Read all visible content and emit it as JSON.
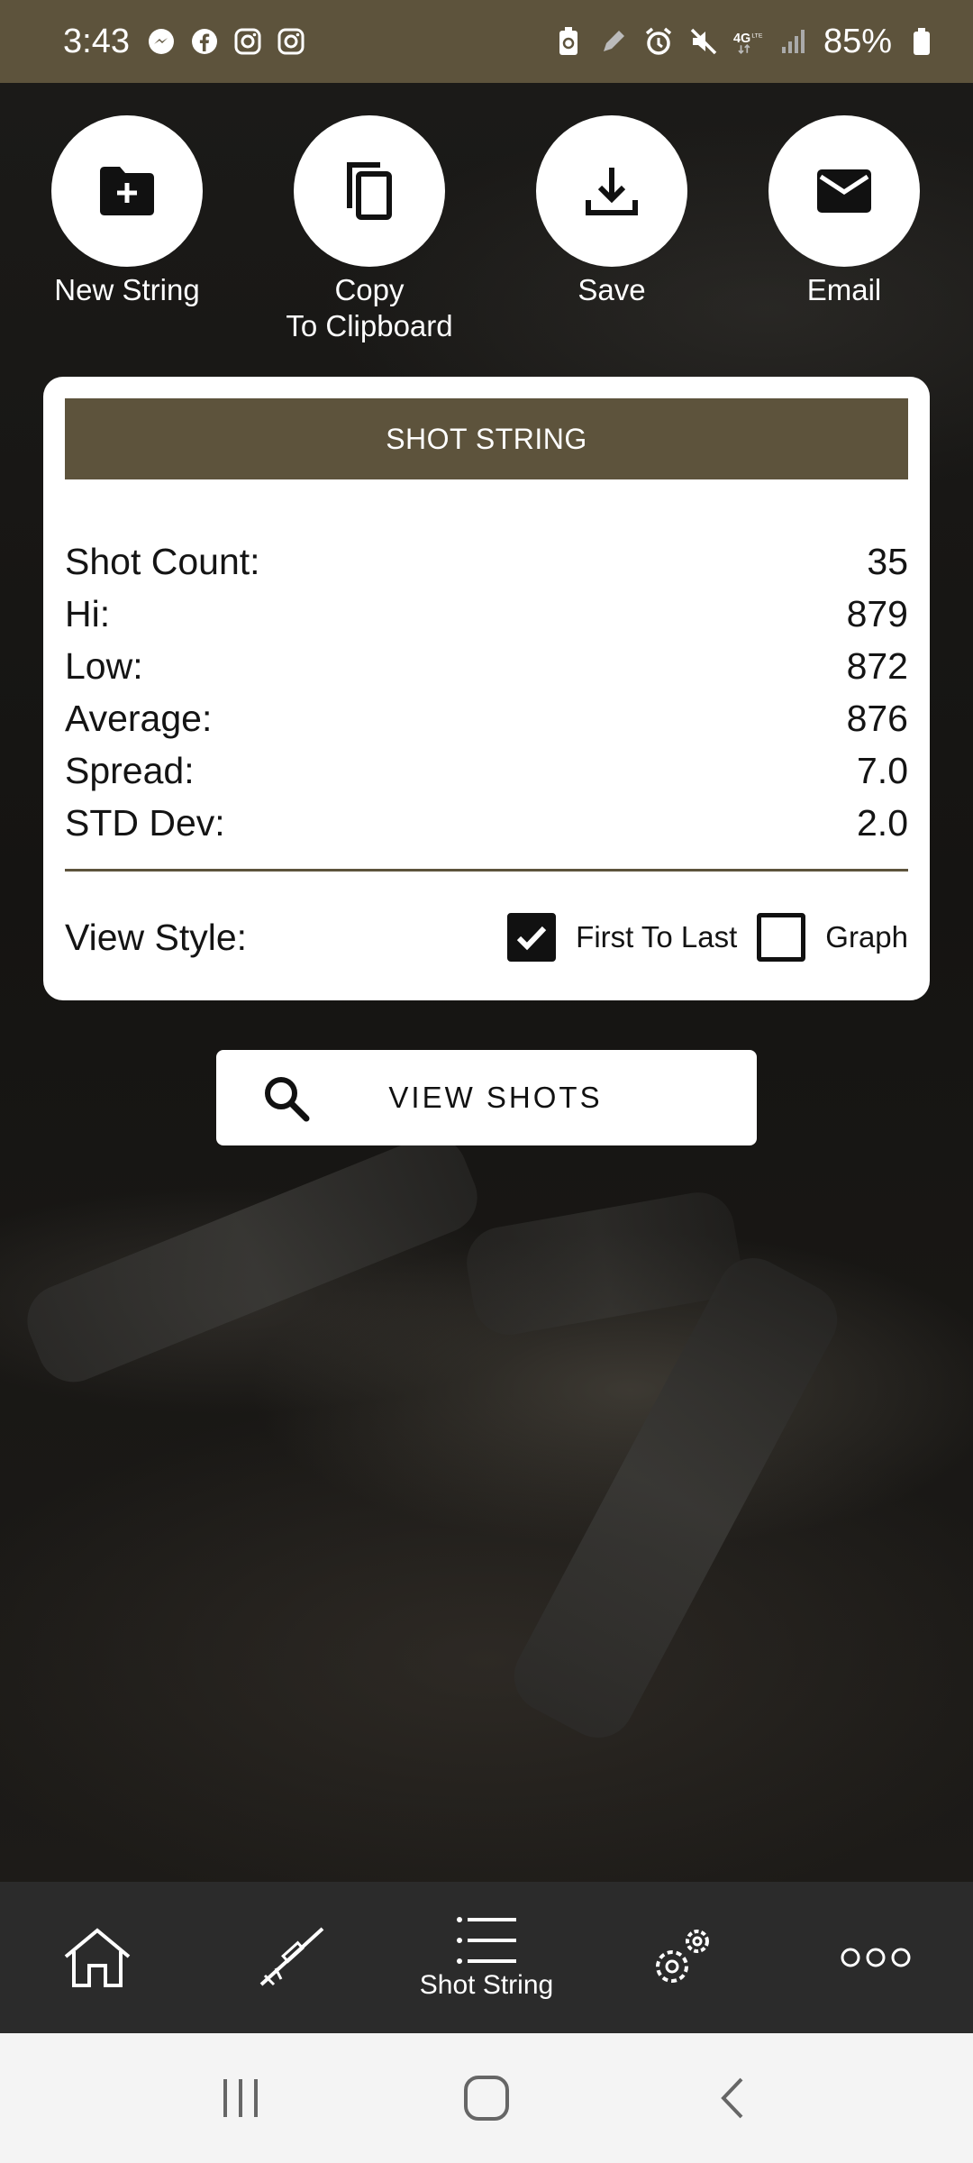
{
  "status_bar": {
    "time": "3:43",
    "left_icons": [
      "messenger-icon",
      "facebook-icon",
      "instagram-icon",
      "instagram-icon"
    ],
    "right_icons": [
      "battery-saver-icon",
      "pen-icon",
      "alarm-icon",
      "mute-icon",
      "4g-lte-icon",
      "signal-icon"
    ],
    "battery": "85%"
  },
  "actions": [
    {
      "label": "New String",
      "icon": "new-folder-icon"
    },
    {
      "label": "Copy\nTo Clipboard",
      "icon": "copy-icon"
    },
    {
      "label": "Save",
      "icon": "download-icon"
    },
    {
      "label": "Email",
      "icon": "email-icon"
    }
  ],
  "card": {
    "title": "SHOT STRING",
    "stats": [
      {
        "label": "Shot Count:",
        "value": "35"
      },
      {
        "label": "Hi:",
        "value": "879"
      },
      {
        "label": "Low:",
        "value": "872"
      },
      {
        "label": "Average:",
        "value": "876"
      },
      {
        "label": "Spread:",
        "value": "7.0"
      },
      {
        "label": "STD Dev:",
        "value": "2.0"
      }
    ],
    "view_style_label": "View Style:",
    "options": [
      {
        "label": "First To Last",
        "checked": true
      },
      {
        "label": "Graph",
        "checked": false
      }
    ]
  },
  "view_shots_button": "VIEW SHOTS",
  "bottom_nav": [
    {
      "icon": "home-icon",
      "label": ""
    },
    {
      "icon": "rifle-icon",
      "label": ""
    },
    {
      "icon": "list-icon",
      "label": "Shot String"
    },
    {
      "icon": "settings-icon",
      "label": ""
    },
    {
      "icon": "more-icon",
      "label": ""
    }
  ],
  "colors": {
    "brand": "#5d533c",
    "nav_bg": "#2b2b2b"
  }
}
